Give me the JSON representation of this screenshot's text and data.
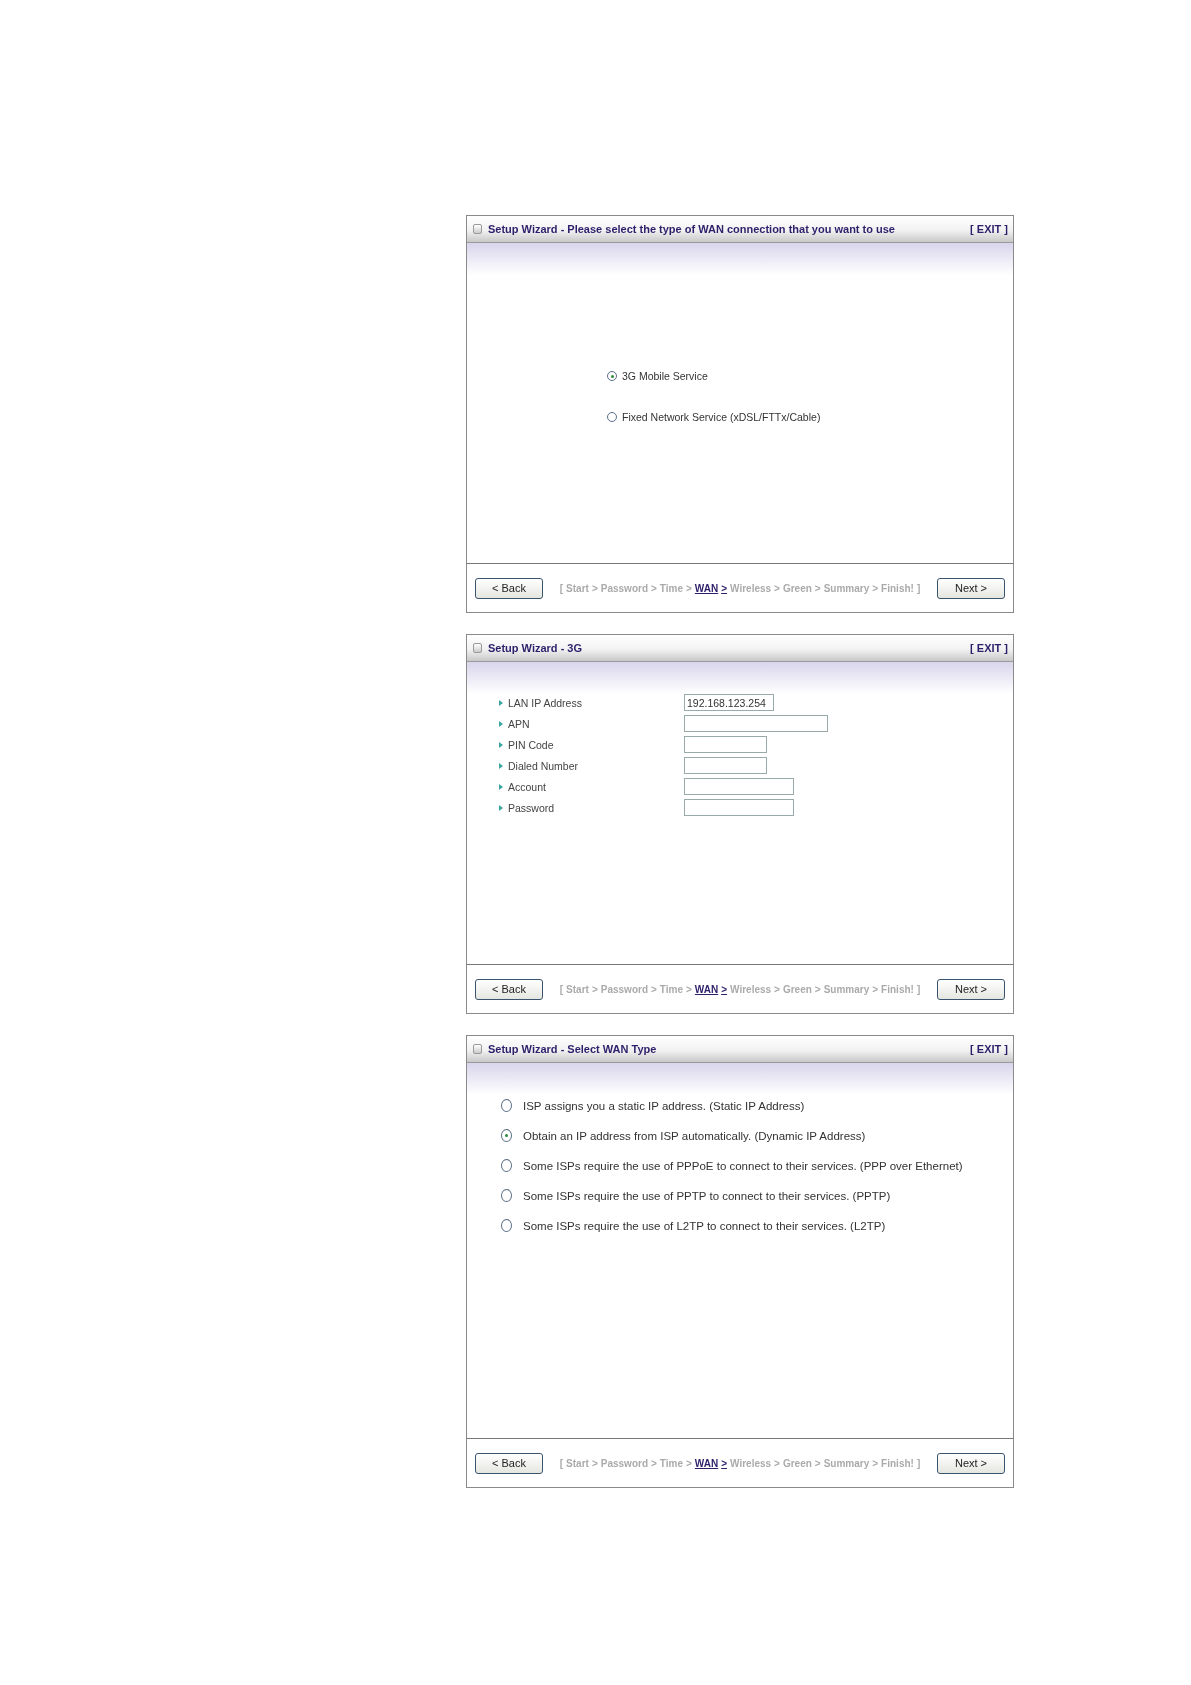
{
  "panels": [
    {
      "kind": "centered-radios",
      "title": "Setup Wizard - Please select the type of WAN connection that you want to use",
      "exit": "[ EXIT ]",
      "options": [
        {
          "label": "3G Mobile Service",
          "selected": true
        },
        {
          "label": "Fixed Network Service (xDSL/FTTx/Cable)",
          "selected": false
        }
      ],
      "back": "< Back",
      "next": "Next >",
      "trail": {
        "open": "[",
        "close": "]",
        "steps": [
          {
            "label": "Start",
            "selected": false
          },
          {
            "label": "Password",
            "selected": false
          },
          {
            "label": "Time",
            "selected": false
          },
          {
            "label": "WAN",
            "selected": true
          },
          {
            "label": "Wireless",
            "selected": false
          },
          {
            "label": "Green",
            "selected": false
          },
          {
            "label": "Summary",
            "selected": false
          },
          {
            "label": "Finish!",
            "selected": false
          }
        ],
        "separators": [
          ">",
          ">",
          ">",
          ">",
          ">",
          ">",
          ">"
        ]
      }
    },
    {
      "kind": "form",
      "title": "Setup Wizard - 3G",
      "exit": "[ EXIT ]",
      "fields": [
        {
          "label": "LAN IP Address",
          "value": "192.168.123.254"
        },
        {
          "label": "APN"
        },
        {
          "label": "PIN Code"
        },
        {
          "label": "Dialed Number"
        },
        {
          "label": "Account"
        },
        {
          "label": "Password"
        }
      ],
      "back": "< Back",
      "next": "Next >",
      "trail": {
        "open": "[",
        "close": "]",
        "steps": [
          {
            "label": "Start",
            "selected": false
          },
          {
            "label": "Password",
            "selected": false
          },
          {
            "label": "Time",
            "selected": false
          },
          {
            "label": "WAN",
            "selected": true
          },
          {
            "label": "Wireless",
            "selected": false
          },
          {
            "label": "Green",
            "selected": false
          },
          {
            "label": "Summary",
            "selected": false
          },
          {
            "label": "Finish!",
            "selected": false
          }
        ],
        "separators": [
          ">",
          ">",
          ">",
          ">",
          ">",
          ">",
          ">"
        ]
      }
    },
    {
      "kind": "radios",
      "title": "Setup Wizard - Select WAN Type",
      "exit": "[ EXIT ]",
      "options": [
        {
          "label": "ISP assigns you a static IP address. (Static IP Address)",
          "selected": false
        },
        {
          "label": "Obtain an IP address from ISP automatically. (Dynamic IP Address)",
          "selected": true
        },
        {
          "label": "Some ISPs require the use of PPPoE to connect to their services. (PPP over Ethernet)",
          "selected": false
        },
        {
          "label": "Some ISPs require the use of PPTP to connect to their services. (PPTP)",
          "selected": false
        },
        {
          "label": "Some ISPs require the use of L2TP to connect to their services. (L2TP)",
          "selected": false
        }
      ],
      "back": "< Back",
      "next": "Next >",
      "trail": {
        "open": "[",
        "close": "]",
        "steps": [
          {
            "label": "Start",
            "selected": false
          },
          {
            "label": "Password",
            "selected": false
          },
          {
            "label": "Time",
            "selected": false
          },
          {
            "label": "WAN",
            "selected": true
          },
          {
            "label": "Wireless",
            "selected": false
          },
          {
            "label": "Green",
            "selected": false
          },
          {
            "label": "Summary",
            "selected": false
          },
          {
            "label": "Finish!",
            "selected": false
          }
        ],
        "separators": [
          ">",
          ">",
          ">",
          ">",
          ">",
          ">",
          ">"
        ]
      }
    }
  ]
}
